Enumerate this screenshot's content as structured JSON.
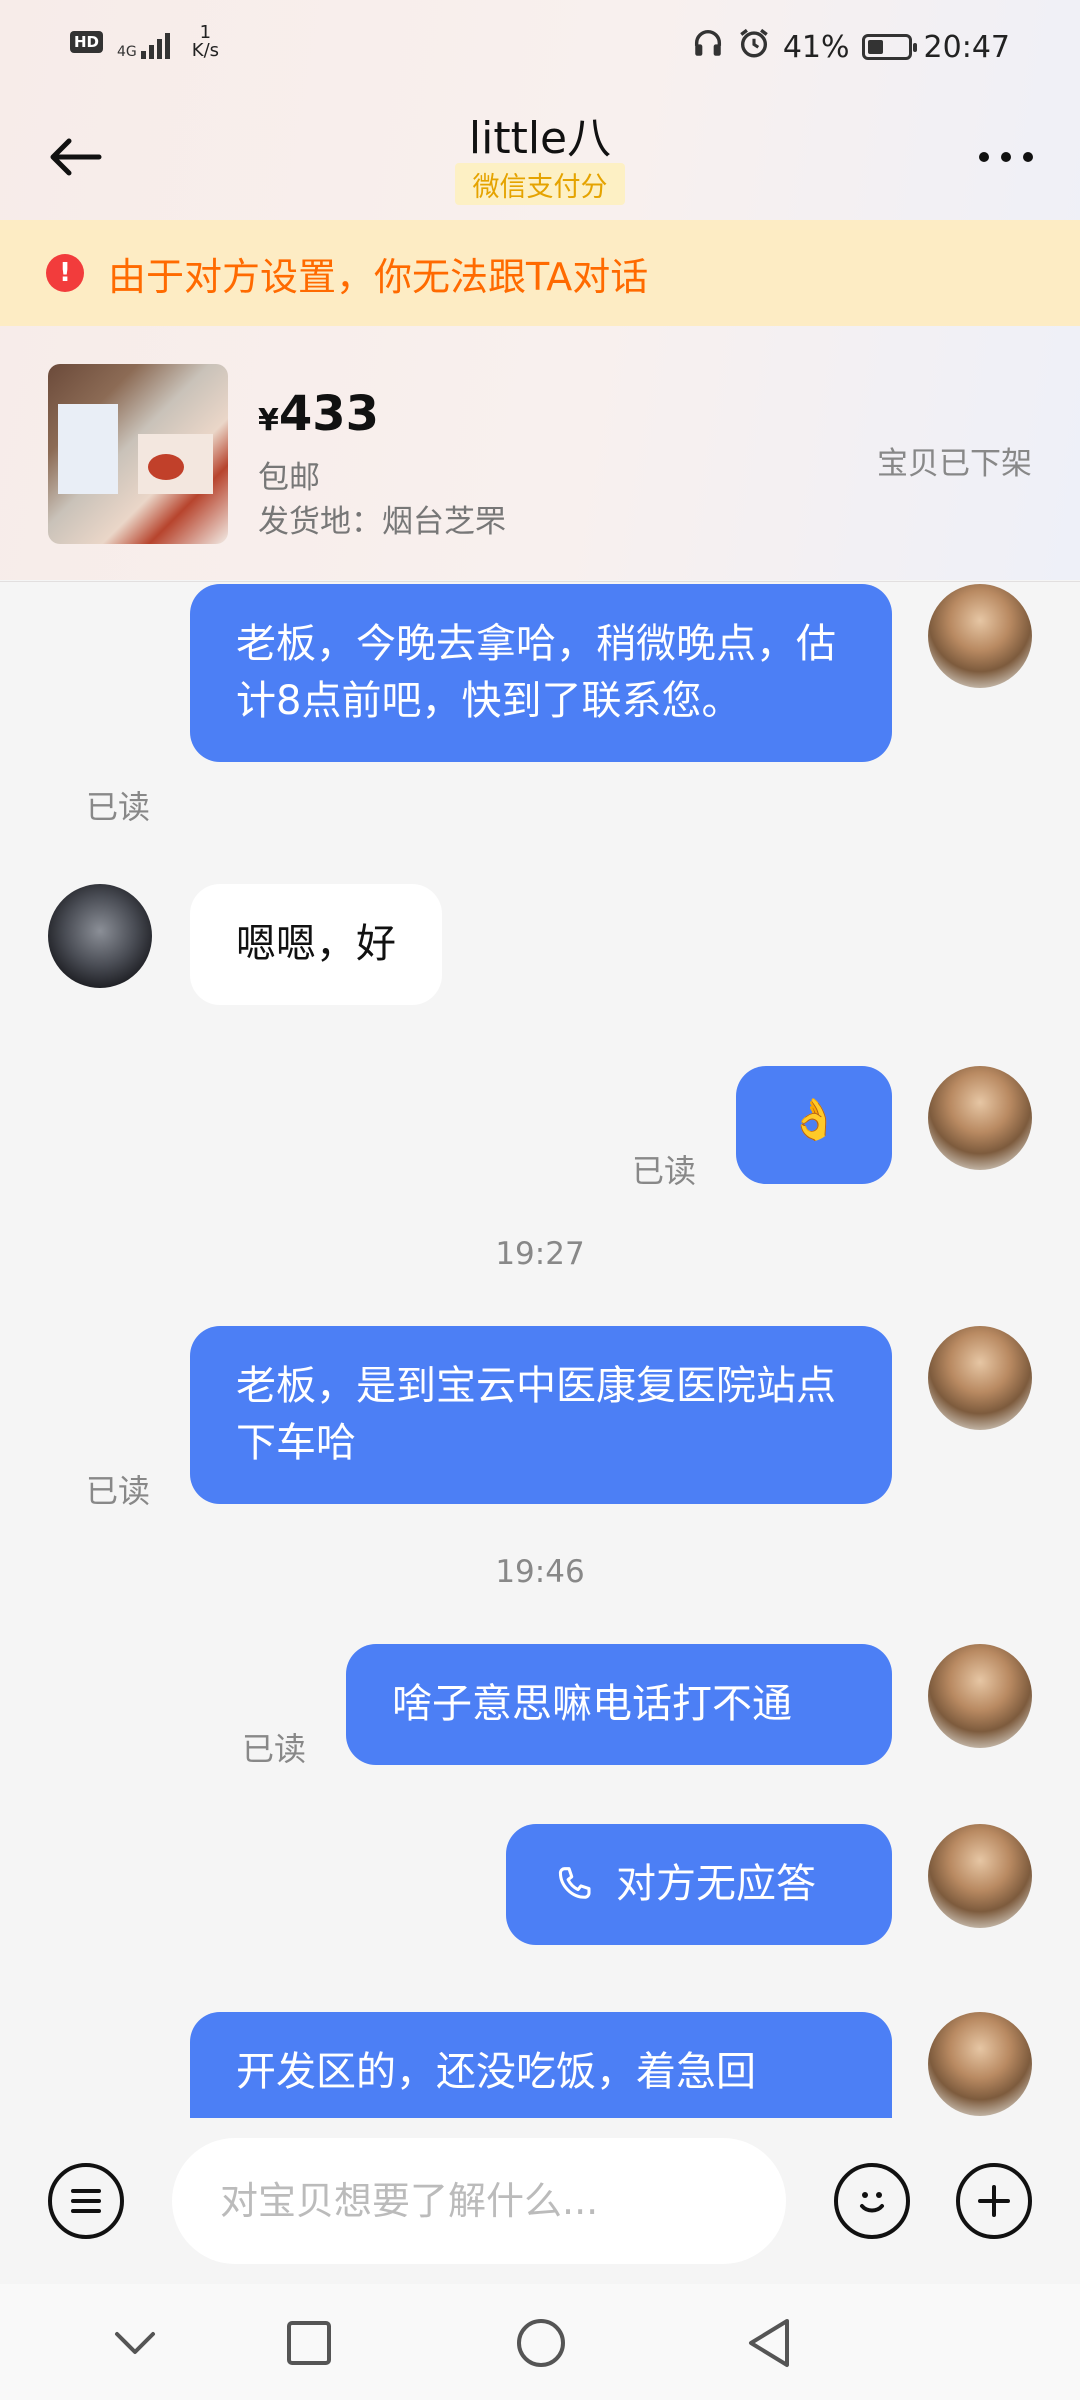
{
  "status_bar": {
    "hd": "HD",
    "network": "4G",
    "speed_value": "1",
    "speed_unit": "K/s",
    "battery_percent": "41%",
    "battery_level": 0.41,
    "time": "20:47",
    "icons": [
      "headphones-icon",
      "alarm-icon",
      "battery-icon",
      "signal-icon"
    ]
  },
  "header": {
    "title": "little八",
    "badge": "微信支付分"
  },
  "banner": {
    "icon": "!",
    "text": "由于对方设置，你无法跟TA对话"
  },
  "product": {
    "currency": "¥",
    "price": "433",
    "shipping": "包邮",
    "origin": "发货地：烟台芝罘",
    "status": "宝贝已下架"
  },
  "chat": {
    "messages": [
      {
        "sender": "me",
        "text": "老板，今晚去拿哈，稍微晚点，估计8点前吧，快到了联系您。",
        "read": "已读"
      },
      {
        "sender": "other",
        "text": "嗯嗯，好"
      },
      {
        "sender": "me",
        "text": "👌",
        "read": "已读"
      },
      {
        "time": "19:27"
      },
      {
        "sender": "me",
        "text": "老板，是到宝云中医康复医院站点下车哈",
        "read": "已读"
      },
      {
        "time": "19:46"
      },
      {
        "sender": "me",
        "text": "啥子意思嘛电话打不通",
        "read": "已读"
      },
      {
        "sender": "me",
        "type": "call",
        "text": "对方无应答"
      },
      {
        "sender": "me",
        "text": "开发区的，还没吃饭，着急回"
      }
    ]
  },
  "input": {
    "placeholder": "对宝贝想要了解什么..."
  },
  "colors": {
    "accent": "#4c7ff5",
    "warning_bg": "#fdecc4",
    "warning_text": "#ff6a00",
    "badge_text": "#e5a300"
  }
}
